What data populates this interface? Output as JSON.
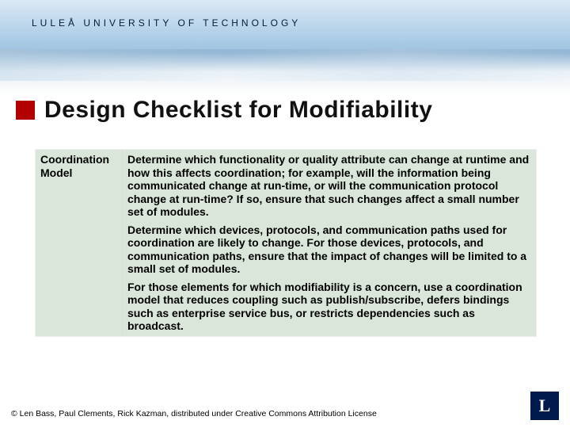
{
  "university": "LULEÅ UNIVERSITY OF TECHNOLOGY",
  "title": "Design Checklist for Modifiability",
  "table": {
    "row_label": "Coordination Model",
    "paragraphs": [
      "Determine which functionality or quality attribute can change at runtime and how this affects coordination; for example, will the information being communicated change at run-time, or will the communication protocol change at run-time? If so, ensure that such changes affect a small number set of modules.",
      "Determine which devices, protocols, and communication paths used for coordination are likely to change. For those devices, protocols, and communication paths, ensure that the impact of changes will be limited to a small set of modules.",
      "For those elements for which modifiability is a concern, use a coordination model that reduces coupling such as publish/subscribe, defers bindings such as enterprise service bus, or restricts dependencies such as broadcast."
    ]
  },
  "footer": "© Len Bass, Paul Clements, Rick Kazman, distributed under Creative Commons Attribution License",
  "logo_letter": "L"
}
